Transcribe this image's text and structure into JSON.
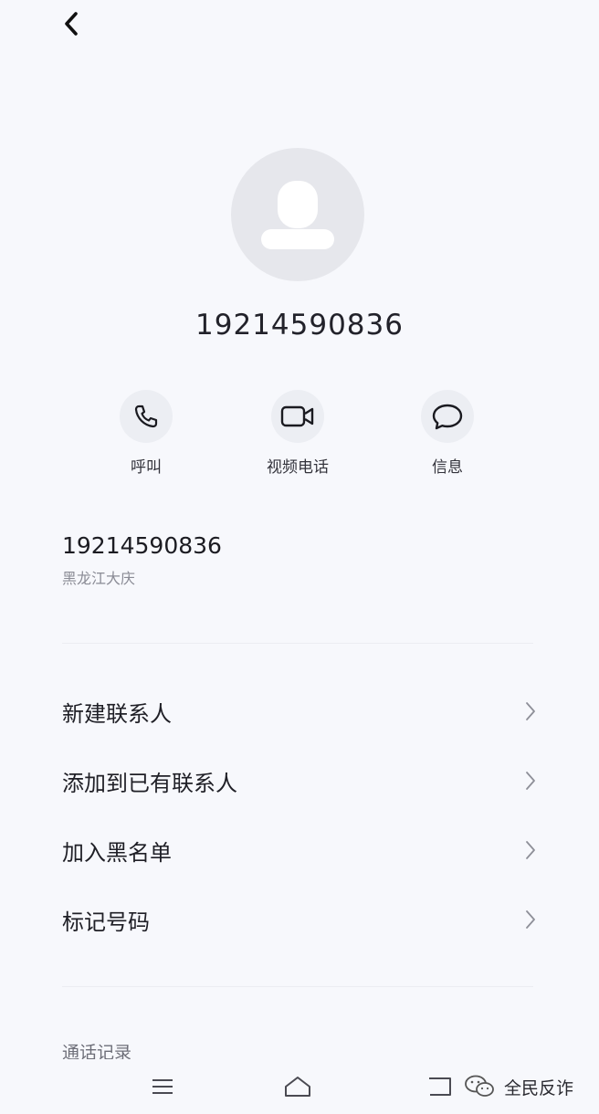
{
  "header": {
    "back_icon": "chevron-left-icon"
  },
  "contact": {
    "avatar_icon": "person-placeholder-icon",
    "number": "19214590836"
  },
  "actions": [
    {
      "label": "呼叫",
      "icon": "phone-icon"
    },
    {
      "label": "视频电话",
      "icon": "video-camera-icon"
    },
    {
      "label": "信息",
      "icon": "message-bubble-icon"
    }
  ],
  "info": {
    "number": "19214590836",
    "location": "黑龙江大庆"
  },
  "menu": [
    {
      "label": "新建联系人"
    },
    {
      "label": "添加到已有联系人"
    },
    {
      "label": "加入黑名单"
    },
    {
      "label": "标记号码"
    }
  ],
  "call_log": {
    "title": "通话记录"
  },
  "nav": {
    "menu_icon": "hamburger-icon",
    "home_icon": "home-icon",
    "back_icon": "return-icon"
  },
  "watermark": {
    "text": "全民反诈",
    "icon": "wechat-logo-icon"
  },
  "colors": {
    "background": "#f7f8fc",
    "avatar_bg": "#e6e7ec",
    "accent_text": "#1c1c22"
  }
}
